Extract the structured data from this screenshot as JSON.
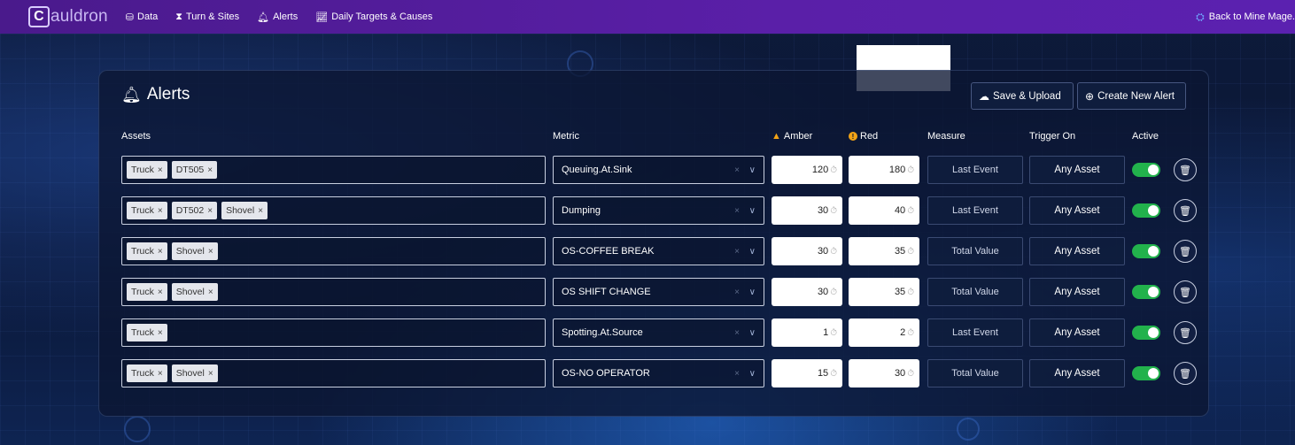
{
  "nav": {
    "logo_mark": "C",
    "logo_text": "auldron",
    "items": [
      {
        "icon": "database-icon",
        "glyph": "⛁",
        "label": "Data"
      },
      {
        "icon": "hourglass-icon",
        "glyph": "⧗",
        "label": "Turn & Sites"
      },
      {
        "icon": "bell-icon",
        "glyph": "🔔︎",
        "label": "Alerts"
      },
      {
        "icon": "chart-line-icon",
        "glyph": "📈︎",
        "label": "Daily Targets & Causes"
      }
    ],
    "back_label": "Back to Mine Mage."
  },
  "panel": {
    "title": "Alerts",
    "save_label": "Save & Upload",
    "create_label": "Create New Alert"
  },
  "columns": {
    "assets": "Assets",
    "metric": "Metric",
    "amber": "Amber",
    "red": "Red",
    "measure": "Measure",
    "trigger": "Trigger On",
    "active": "Active"
  },
  "rows": [
    {
      "tags": [
        "Truck",
        "DT505"
      ],
      "metric": "Queuing.At.Sink",
      "amber": "120",
      "red": "180",
      "measure": "Last Event",
      "trigger": "Any Asset",
      "active": true
    },
    {
      "tags": [
        "Truck",
        "DT502",
        "Shovel"
      ],
      "metric": "Dumping",
      "amber": "30",
      "red": "40",
      "measure": "Last Event",
      "trigger": "Any Asset",
      "active": true
    },
    {
      "tags": [
        "Truck",
        "Shovel"
      ],
      "metric": "OS-COFFEE BREAK",
      "amber": "30",
      "red": "35",
      "measure": "Total Value",
      "trigger": "Any Asset",
      "active": true
    },
    {
      "tags": [
        "Truck",
        "Shovel"
      ],
      "metric": "OS SHIFT CHANGE",
      "amber": "30",
      "red": "35",
      "measure": "Total Value",
      "trigger": "Any Asset",
      "active": true
    },
    {
      "tags": [
        "Truck"
      ],
      "metric": "Spotting.At.Source",
      "amber": "1",
      "red": "2",
      "measure": "Last Event",
      "trigger": "Any Asset",
      "active": true
    },
    {
      "tags": [
        "Truck",
        "Shovel"
      ],
      "metric": "OS-NO OPERATOR",
      "amber": "15",
      "red": "30",
      "measure": "Total Value",
      "trigger": "Any Asset",
      "active": true
    }
  ],
  "colors": {
    "nav": "#5a1fa8",
    "toggle_on": "#22b24c",
    "amber": "#f2a316"
  }
}
